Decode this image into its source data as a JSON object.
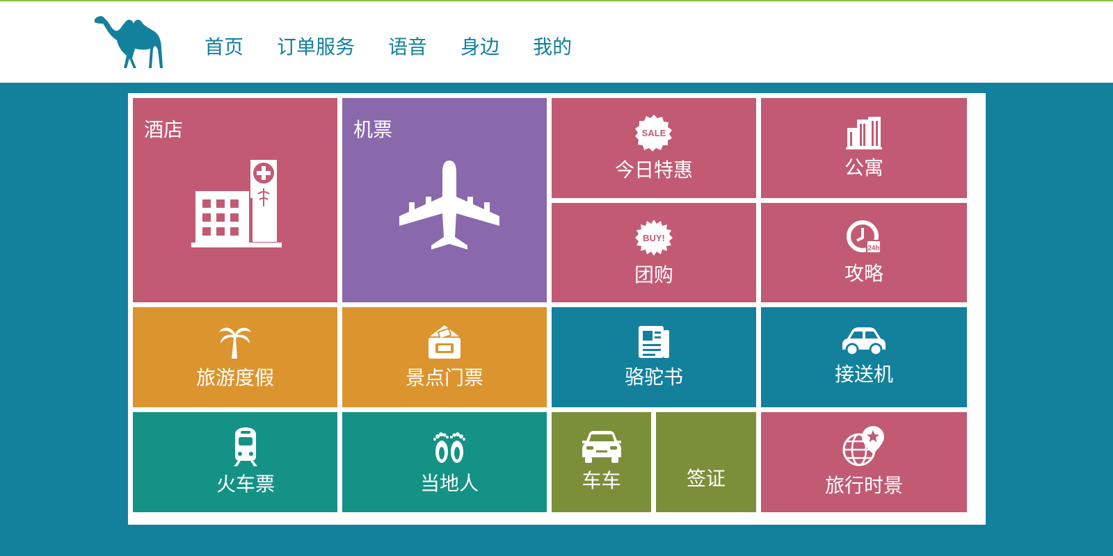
{
  "nav": {
    "items": [
      "首页",
      "订单服务",
      "语音",
      "身边",
      "我的"
    ]
  },
  "tiles": {
    "hotel": "酒店",
    "flight": "机票",
    "deals": "今日特惠",
    "apartment": "公寓",
    "group_buy": "团购",
    "guide": "攻略",
    "vacation": "旅游度假",
    "attraction_tickets": "景点门票",
    "camel_book": "骆驼书",
    "airport_transfer": "接送机",
    "train_tickets": "火车票",
    "locals": "当地人",
    "car": "车车",
    "visa": "签证",
    "travel_moments": "旅行时景"
  },
  "icons": {
    "sale_badge_text": "SALE",
    "buy_badge_text": "BUY!",
    "clock_badge_text": "24h"
  },
  "colors": {
    "brand": "#13809c",
    "pink": "#c25a73",
    "purple": "#8968ab",
    "orange": "#dc942f",
    "teal": "#149285",
    "olive": "#7b8f3a",
    "accent_line": "#8cc540"
  }
}
